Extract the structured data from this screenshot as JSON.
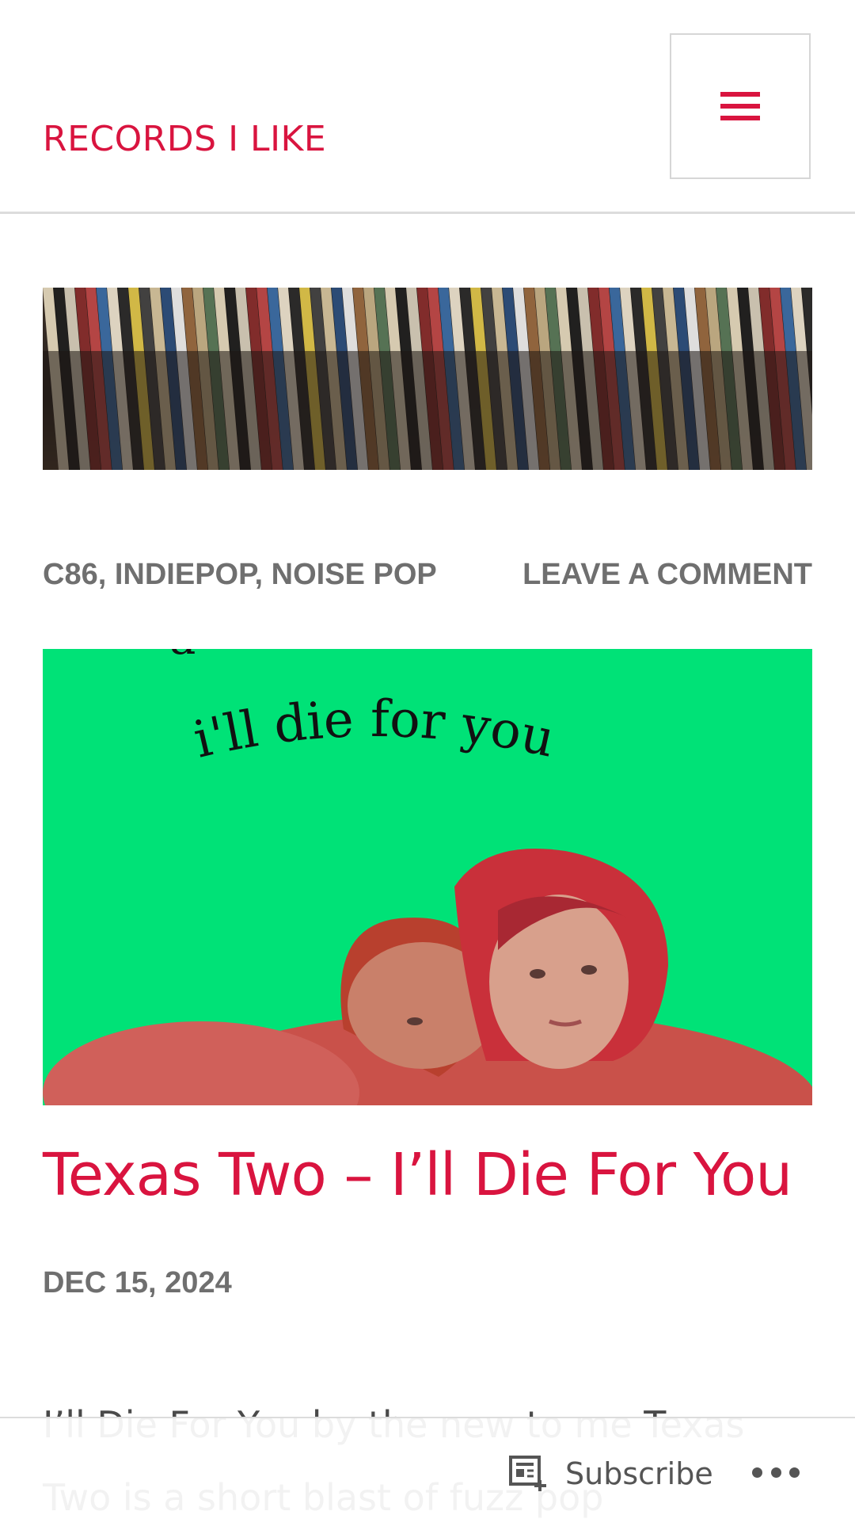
{
  "site": {
    "title": "RECORDS I LIKE"
  },
  "menu": {
    "icon": "hamburger-menu-icon"
  },
  "post": {
    "categories": [
      "C86",
      "INDIEPOP",
      "NOISE POP"
    ],
    "category_separator": ", ",
    "comment_link": "LEAVE A COMMENT",
    "image_text": "i'll die for you",
    "title": "Texas Two – I’ll Die For You",
    "date": "DEC 15, 2024",
    "excerpt": "I’ll Die For You by the new to me Texas Two is a short blast of fuzz pop"
  },
  "bottom_bar": {
    "subscribe_label": "Subscribe",
    "subscribe_icon": "reader-subscribe-icon",
    "more_icon": "more-horizontal-icon"
  },
  "colors": {
    "accent": "#d9143f",
    "meta_gray": "#6f6f6f",
    "featured_bg": "#00e277"
  }
}
